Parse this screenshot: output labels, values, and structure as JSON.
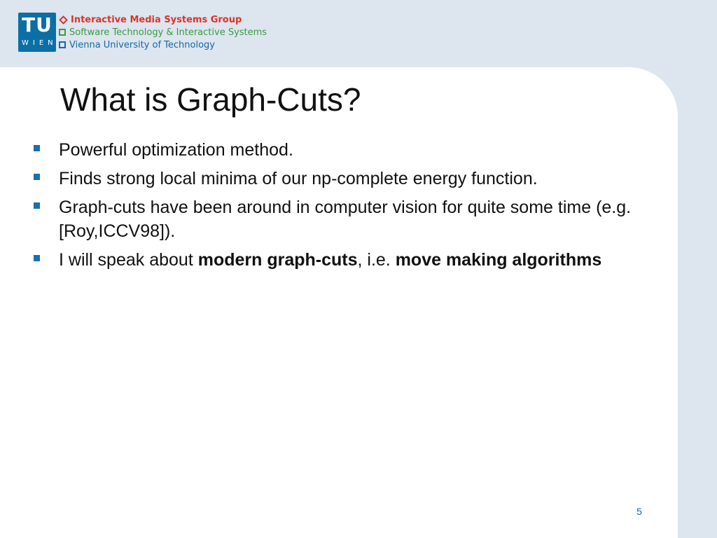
{
  "header": {
    "logo_top": "TU",
    "logo_bottom": "WIEN",
    "lines": [
      {
        "text": "Interactive Media Systems Group",
        "color": "#d9352b"
      },
      {
        "text": "Software Technology & Interactive Systems",
        "color": "#3a9a43"
      },
      {
        "text": "Vienna University of Technology",
        "color": "#1468a8"
      }
    ],
    "logo_color": "#0b6fa6"
  },
  "slide": {
    "title": "What is Graph-Cuts?",
    "bullets": [
      {
        "text": "Powerful optimization method."
      },
      {
        "text": "Finds strong local minima of our np-complete energy function."
      },
      {
        "text": "Graph-cuts have been around in computer vision for quite some time (e.g. [Roy,ICCV98])."
      },
      {
        "parts": [
          "I will speak about ",
          "modern graph-cuts",
          ", i.e. ",
          "move making algorithms"
        ]
      }
    ],
    "page_number": "5"
  }
}
